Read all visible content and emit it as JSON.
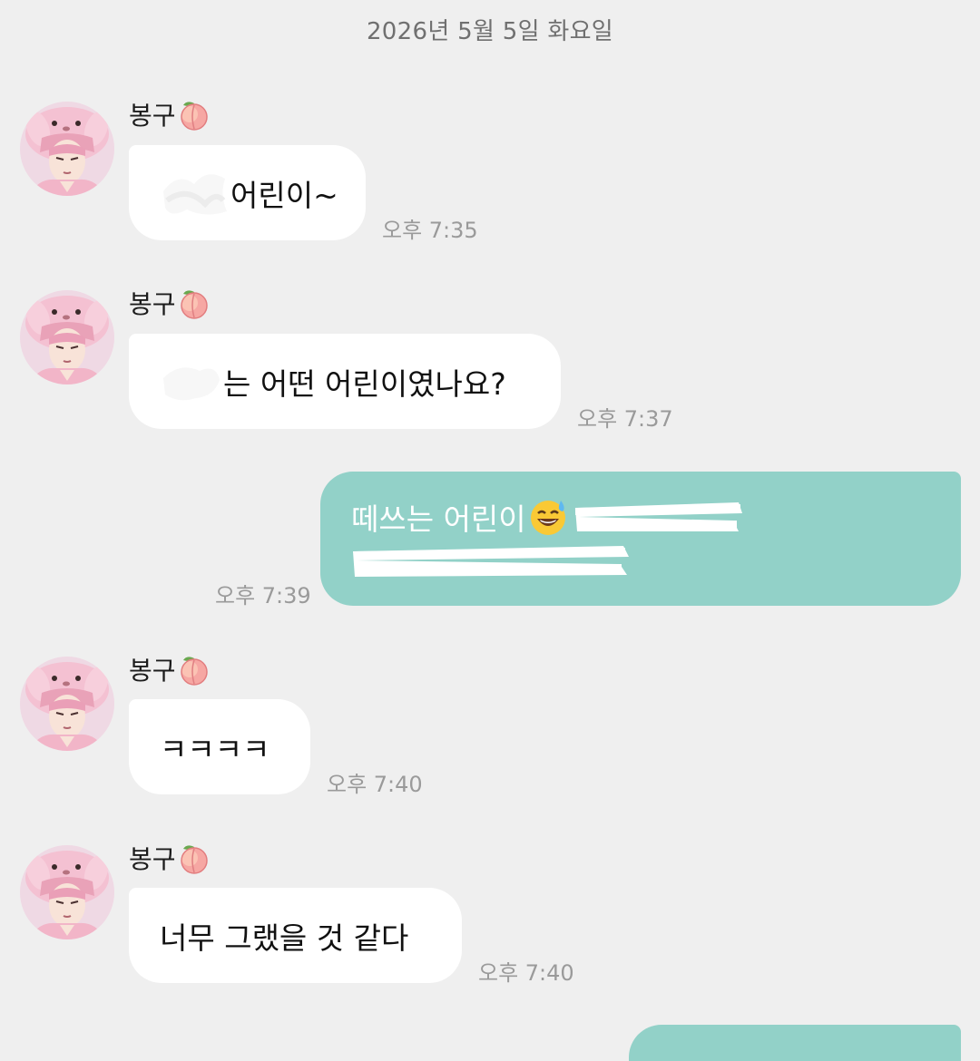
{
  "chat": {
    "date": "2026년 5월 5일 화요일",
    "sender_name": "봉구",
    "messages": [
      {
        "direction": "in",
        "text": "어린이~",
        "time": "오후 7:35",
        "has_redaction": true
      },
      {
        "direction": "in",
        "text": "는 어떤 어린이였나요?",
        "time": "오후 7:37",
        "has_redaction": true
      },
      {
        "direction": "out",
        "text": "떼쓰는 어린이",
        "emoji": "sweat-smile-emoji",
        "time": "오후 7:39",
        "has_redaction": true
      },
      {
        "direction": "in",
        "text": "ㅋㅋㅋㅋ",
        "time": "오후 7:40"
      },
      {
        "direction": "in",
        "text": "너무 그랬을 것 같다",
        "time": "오후 7:40"
      }
    ]
  },
  "theme": {
    "background": "#efefef",
    "incoming_bubble": "#ffffff",
    "outgoing_bubble": "#92d1c8",
    "timestamp": "#9a9a9a"
  },
  "icons": {
    "sender_badge": "peach-icon",
    "avatar": "avatar-pink-bunny-hood"
  }
}
